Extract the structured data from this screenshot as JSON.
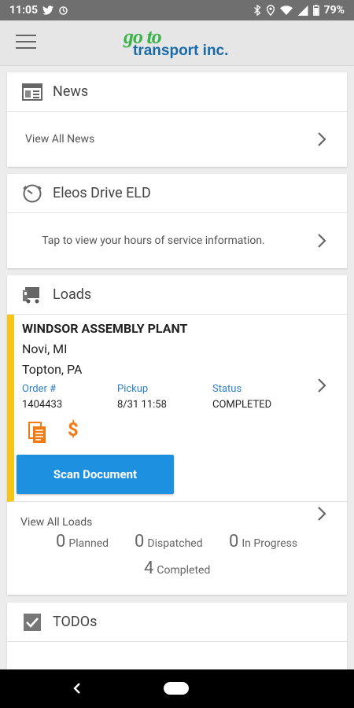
{
  "status_bar": {
    "time": "11:05",
    "battery": "79%"
  },
  "header": {
    "logo_top": "go to",
    "logo_bottom": "transport inc."
  },
  "news": {
    "title": "News",
    "link": "View All News"
  },
  "eld": {
    "title": "Eleos Drive ELD",
    "link": "Tap to view your hours of service information."
  },
  "loads": {
    "title": "Loads",
    "item": {
      "name": "WINDSOR ASSEMBLY PLANT",
      "origin": "Novi, MI",
      "destination": "Topton, PA",
      "order_label": "Order #",
      "order_value": "1404433",
      "pickup_label": "Pickup",
      "pickup_value": "8/31 11:58",
      "status_label": "Status",
      "status_value": "COMPLETED",
      "scan_button": "Scan Document"
    },
    "view_all": "View All Loads",
    "stats": {
      "planned_count": "0",
      "planned_label": "Planned",
      "dispatched_count": "0",
      "dispatched_label": "Dispatched",
      "in_progress_count": "0",
      "in_progress_label": "In Progress",
      "completed_count": "4",
      "completed_label": "Completed"
    }
  },
  "todos": {
    "title": "TODOs"
  },
  "colors": {
    "accent_blue": "#1e90e0",
    "load_stripe": "#f5c518",
    "icon_orange": "#f07a14",
    "logo_green": "#3bb34a",
    "logo_blue": "#1b6aa8"
  }
}
